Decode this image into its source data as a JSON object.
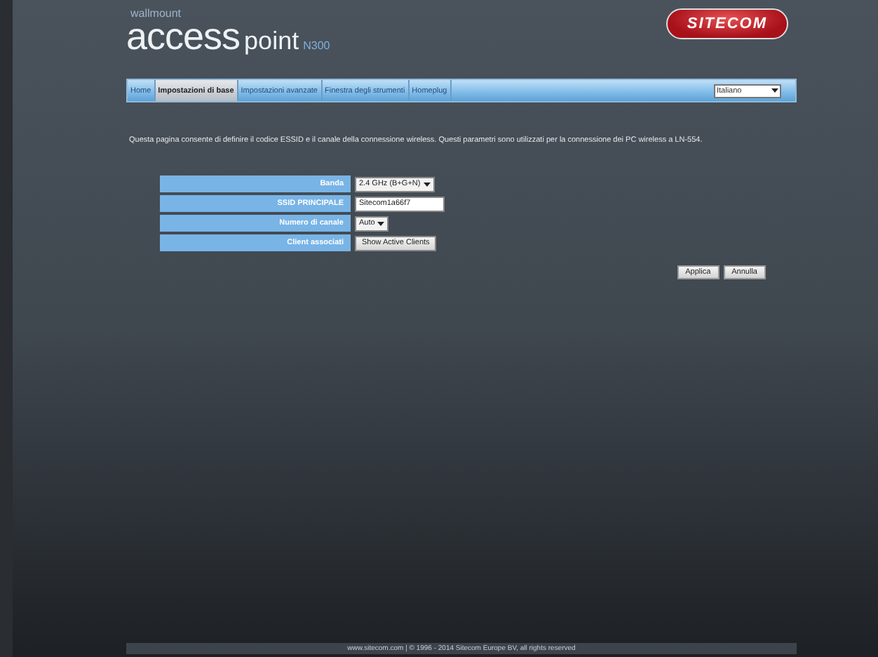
{
  "header": {
    "tagline": "wallmount",
    "product": "access",
    "product_suffix": "point",
    "model": "N300",
    "brand": "SITECOM"
  },
  "nav": {
    "tabs": [
      {
        "label": "Home",
        "selected": false
      },
      {
        "label": "Impostazioni di base",
        "selected": true
      },
      {
        "label": "Impostazioni avanzate",
        "selected": false
      },
      {
        "label": "Finestra degli strumenti",
        "selected": false
      },
      {
        "label": "Homeplug",
        "selected": false
      }
    ],
    "language": "Italiano"
  },
  "description": "Questa pagina consente di definire il codice ESSID e il canale della connessione wireless. Questi parametri sono utilizzati per la connessione dei PC wireless a LN-554.",
  "form": [
    {
      "label": "Banda",
      "kind": "select",
      "value": "2.4 GHz (B+G+N)"
    },
    {
      "label": "SSID PRINCIPALE",
      "kind": "input",
      "value": "Sitecom1a66f7"
    },
    {
      "label": "Numero di canale",
      "kind": "select",
      "value": "Auto"
    },
    {
      "label": "Client associati",
      "kind": "button",
      "value": "Show Active Clients"
    }
  ],
  "buttons": [
    "Applica",
    "Annulla"
  ],
  "footer": "www.sitecom.com | © 1996 - 2014 Sitecom Europe BV, all rights reserved"
}
